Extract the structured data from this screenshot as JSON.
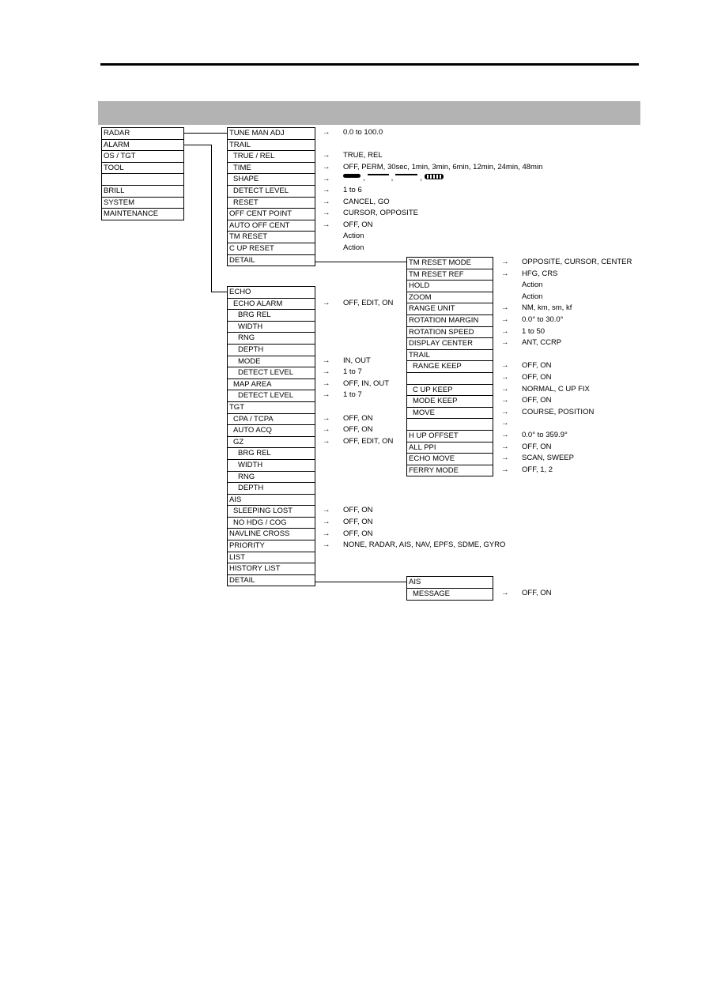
{
  "main_menu": [
    "RADAR",
    "ALARM",
    "OS / TGT",
    "TOOL",
    "",
    "BRILL",
    "SYSTEM",
    "MAINTENANCE"
  ],
  "radar_menu": [
    {
      "label": "TUNE MAN ADJ",
      "indent": 0,
      "options": "0.0 to 100.0",
      "arrow": true
    },
    {
      "label": "TRAIL",
      "indent": 0,
      "options": "",
      "arrow": false
    },
    {
      "label": "TRUE / REL",
      "indent": 1,
      "options": "TRUE, REL",
      "arrow": true
    },
    {
      "label": "TIME",
      "indent": 1,
      "options": "OFF, PERM, 30sec, 1min, 3min, 6min, 12min, 24min, 48min",
      "arrow": true
    },
    {
      "label": "SHAPE",
      "indent": 1,
      "options": "[trail-shape-icons]",
      "arrow": true
    },
    {
      "label": "DETECT LEVEL",
      "indent": 1,
      "options": "1 to 6",
      "arrow": true
    },
    {
      "label": "RESET",
      "indent": 1,
      "options": "CANCEL, GO",
      "arrow": true
    },
    {
      "label": "OFF CENT POINT",
      "indent": 0,
      "options": "CURSOR, OPPOSITE",
      "arrow": true
    },
    {
      "label": "AUTO OFF CENT",
      "indent": 0,
      "options": "OFF, ON",
      "arrow": true
    },
    {
      "label": "TM RESET",
      "indent": 0,
      "options": "Action",
      "arrow": false
    },
    {
      "label": "C UP RESET",
      "indent": 0,
      "options": "Action",
      "arrow": false
    },
    {
      "label": "DETAIL",
      "indent": 0,
      "options": "",
      "arrow": false
    }
  ],
  "radar_detail_menu": [
    {
      "label": "TM RESET MODE",
      "indent": 0,
      "options": "OPPOSITE, CURSOR, CENTER",
      "arrow": true
    },
    {
      "label": "TM RESET REF",
      "indent": 0,
      "options": "HFG, CRS",
      "arrow": true
    },
    {
      "label": "HOLD",
      "indent": 0,
      "options": "Action",
      "arrow": false
    },
    {
      "label": "ZOOM",
      "indent": 0,
      "options": "Action",
      "arrow": false
    },
    {
      "label": "RANGE UNIT",
      "indent": 0,
      "options": "NM, km, sm, kf",
      "arrow": true
    },
    {
      "label": "ROTATION MARGIN",
      "indent": 0,
      "options": "0.0° to 30.0°",
      "arrow": true
    },
    {
      "label": "ROTATION SPEED",
      "indent": 0,
      "options": "1 to 50",
      "arrow": true
    },
    {
      "label": "DISPLAY CENTER",
      "indent": 0,
      "options": "ANT, CCRP",
      "arrow": true
    },
    {
      "label": "TRAIL",
      "indent": 0,
      "options": "",
      "arrow": false
    },
    {
      "label": "RANGE KEEP",
      "indent": 1,
      "options": "OFF, ON",
      "arrow": true
    },
    {
      "label": "",
      "indent": 1,
      "options": "OFF, ON",
      "arrow": true
    },
    {
      "label": "C UP KEEP",
      "indent": 1,
      "options": "NORMAL, C UP FIX",
      "arrow": true
    },
    {
      "label": "MODE KEEP",
      "indent": 1,
      "options": "OFF, ON",
      "arrow": true
    },
    {
      "label": "MOVE",
      "indent": 1,
      "options": "COURSE, POSITION",
      "arrow": true
    },
    {
      "label": "",
      "indent": 0,
      "options": "",
      "arrow": true
    },
    {
      "label": "H UP OFFSET",
      "indent": 0,
      "options": "0.0° to 359.9°",
      "arrow": true
    },
    {
      "label": "ALL PPI",
      "indent": 0,
      "options": "OFF, ON",
      "arrow": true
    },
    {
      "label": "ECHO MOVE",
      "indent": 0,
      "options": "SCAN, SWEEP",
      "arrow": true
    },
    {
      "label": "FERRY MODE",
      "indent": 0,
      "options": "OFF, 1, 2",
      "arrow": true
    }
  ],
  "alarm_menu": [
    {
      "label": "ECHO",
      "indent": 0,
      "options": "",
      "arrow": false
    },
    {
      "label": "ECHO ALARM",
      "indent": 1,
      "options": "OFF, EDIT, ON",
      "arrow": true
    },
    {
      "label": "BRG REL",
      "indent": 2,
      "options": "",
      "arrow": false
    },
    {
      "label": "WIDTH",
      "indent": 2,
      "options": "",
      "arrow": false
    },
    {
      "label": "RNG",
      "indent": 2,
      "options": "",
      "arrow": false
    },
    {
      "label": "DEPTH",
      "indent": 2,
      "options": "",
      "arrow": false
    },
    {
      "label": "MODE",
      "indent": 2,
      "options": "IN, OUT",
      "arrow": true
    },
    {
      "label": "DETECT LEVEL",
      "indent": 2,
      "options": "1 to 7",
      "arrow": true
    },
    {
      "label": "MAP AREA",
      "indent": 1,
      "options": "OFF, IN, OUT",
      "arrow": true
    },
    {
      "label": "DETECT LEVEL",
      "indent": 2,
      "options": "1 to 7",
      "arrow": true
    },
    {
      "label": "TGT",
      "indent": 0,
      "options": "",
      "arrow": false
    },
    {
      "label": "CPA / TCPA",
      "indent": 1,
      "options": "OFF, ON",
      "arrow": true
    },
    {
      "label": "AUTO ACQ",
      "indent": 1,
      "options": "OFF, ON",
      "arrow": true
    },
    {
      "label": "GZ",
      "indent": 1,
      "options": "OFF, EDIT, ON",
      "arrow": true
    },
    {
      "label": "BRG REL",
      "indent": 2,
      "options": "",
      "arrow": false
    },
    {
      "label": "WIDTH",
      "indent": 2,
      "options": "",
      "arrow": false
    },
    {
      "label": "RNG",
      "indent": 2,
      "options": "",
      "arrow": false
    },
    {
      "label": "DEPTH",
      "indent": 2,
      "options": "",
      "arrow": false
    },
    {
      "label": "AIS",
      "indent": 0,
      "options": "",
      "arrow": false
    },
    {
      "label": "SLEEPING LOST",
      "indent": 1,
      "options": "OFF, ON",
      "arrow": true
    },
    {
      "label": "NO HDG / COG",
      "indent": 1,
      "options": "OFF, ON",
      "arrow": true
    },
    {
      "label": "NAVLINE CROSS",
      "indent": 0,
      "options": "OFF, ON",
      "arrow": true
    },
    {
      "label": "PRIORITY",
      "indent": 0,
      "options": "NONE, RADAR, AIS, NAV, EPFS, SDME, GYRO",
      "arrow": true
    },
    {
      "label": "LIST",
      "indent": 0,
      "options": "",
      "arrow": false
    },
    {
      "label": "HISTORY LIST",
      "indent": 0,
      "options": "",
      "arrow": false
    },
    {
      "label": "DETAIL",
      "indent": 0,
      "options": "",
      "arrow": false
    }
  ],
  "alarm_detail_menu": [
    {
      "label": "AIS",
      "indent": 0,
      "options": "",
      "arrow": false
    },
    {
      "label": "MESSAGE",
      "indent": 1,
      "options": "OFF, ON",
      "arrow": true
    }
  ],
  "arrow_glyph": "→"
}
